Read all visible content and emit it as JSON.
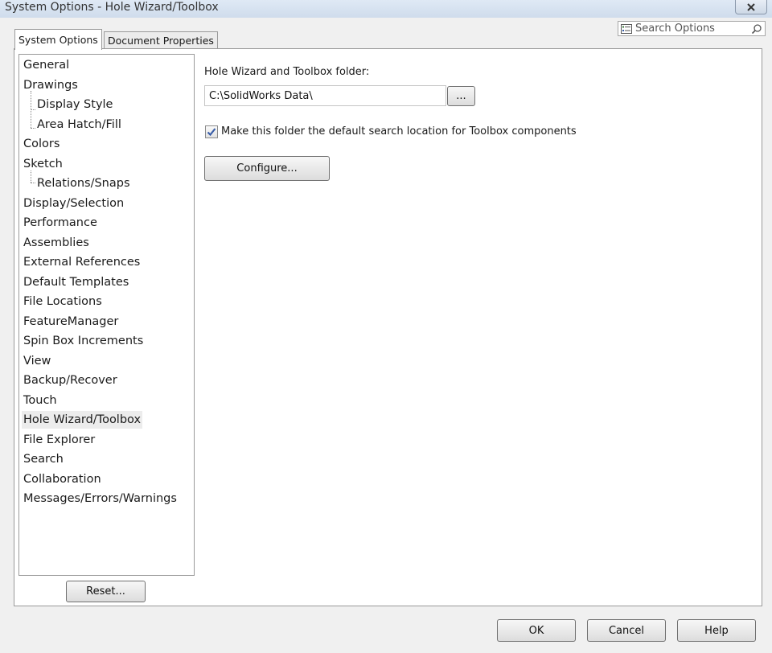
{
  "window": {
    "title": "System Options - Hole Wizard/Toolbox"
  },
  "tabs": [
    {
      "label": "System Options",
      "active": true
    },
    {
      "label": "Document Properties",
      "active": false
    }
  ],
  "search": {
    "placeholder": "Search Options"
  },
  "tree": {
    "items": [
      {
        "label": "General",
        "level": 0
      },
      {
        "label": "Drawings",
        "level": 0
      },
      {
        "label": "Display Style",
        "level": 1
      },
      {
        "label": "Area Hatch/Fill",
        "level": 1
      },
      {
        "label": "Colors",
        "level": 0
      },
      {
        "label": "Sketch",
        "level": 0
      },
      {
        "label": "Relations/Snaps",
        "level": 1
      },
      {
        "label": "Display/Selection",
        "level": 0
      },
      {
        "label": "Performance",
        "level": 0
      },
      {
        "label": "Assemblies",
        "level": 0
      },
      {
        "label": "External References",
        "level": 0
      },
      {
        "label": "Default Templates",
        "level": 0
      },
      {
        "label": "File Locations",
        "level": 0
      },
      {
        "label": "FeatureManager",
        "level": 0
      },
      {
        "label": "Spin Box Increments",
        "level": 0
      },
      {
        "label": "View",
        "level": 0
      },
      {
        "label": "Backup/Recover",
        "level": 0
      },
      {
        "label": "Touch",
        "level": 0
      },
      {
        "label": "Hole Wizard/Toolbox",
        "level": 0,
        "selected": true
      },
      {
        "label": "File Explorer",
        "level": 0
      },
      {
        "label": "Search",
        "level": 0
      },
      {
        "label": "Collaboration",
        "level": 0
      },
      {
        "label": "Messages/Errors/Warnings",
        "level": 0
      }
    ],
    "reset_label": "Reset..."
  },
  "content": {
    "folder_label": "Hole Wizard and Toolbox folder:",
    "folder_value": "C:\\SolidWorks Data\\",
    "browse_label": "...",
    "default_search_label": "Make this folder the default search location for Toolbox components",
    "default_search_checked": true,
    "configure_label": "Configure..."
  },
  "footer": {
    "ok_label": "OK",
    "cancel_label": "Cancel",
    "help_label": "Help"
  },
  "colors": {
    "checkmark": "#3a5ea8"
  }
}
